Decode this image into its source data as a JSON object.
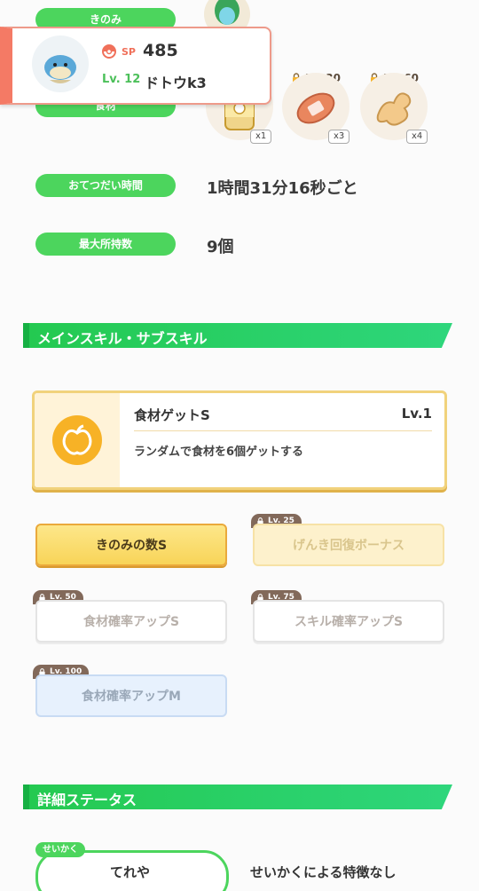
{
  "berry": {
    "label": "きのみ"
  },
  "ingredients": {
    "label": "食材",
    "items": [
      {
        "name": "honey-icon",
        "level": "",
        "count": "x1"
      },
      {
        "name": "sausage-icon",
        "level": "Lv. 30",
        "count": "x3"
      },
      {
        "name": "ginger-icon",
        "level": "Lv. 60",
        "count": "x4"
      }
    ]
  },
  "pokemon": {
    "sp_label": "SP",
    "sp_value": "485",
    "level": "Lv. 12",
    "name": "ドトウk3"
  },
  "help_time": {
    "label": "おてつだい時間",
    "value": "1時間31分16秒ごと"
  },
  "max_carry": {
    "label": "最大所持数",
    "value": "9個"
  },
  "skills_section": {
    "title": "メインスキル・サブスキル"
  },
  "main_skill": {
    "name": "食材ゲットS",
    "level": "Lv.1",
    "description": "ランダムで食材を6個ゲットする"
  },
  "sub_skills": [
    {
      "label": "きのみの数S",
      "lock": ""
    },
    {
      "label": "げんき回復ボーナス",
      "lock": "Lv. 25"
    },
    {
      "label": "食材確率アップS",
      "lock": "Lv. 50"
    },
    {
      "label": "スキル確率アップS",
      "lock": "Lv. 75"
    },
    {
      "label": "食材確率アップM",
      "lock": "Lv. 100"
    }
  ],
  "status_section": {
    "title": "詳細ステータス"
  },
  "nature": {
    "tag": "せいかく",
    "name": "てれや",
    "effect": "せいかくによる特徴なし"
  },
  "colors": {
    "green": "#4cd55d",
    "accent_red": "#f47a65",
    "gold": "#f8d458",
    "lock_brown": "#82695a"
  }
}
